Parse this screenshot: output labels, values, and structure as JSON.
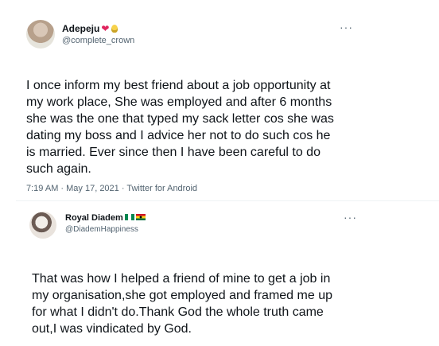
{
  "tweet1": {
    "display_name": "Adepeju",
    "handle": "@complete_crown",
    "text": "I once inform my best friend about a job opportunity at\nmy work place, She was employed and after 6 months\nshe was the one that typed my sack letter cos she was\ndating my boss and I advice her not to do such cos he\nis married. Ever since then I have been careful to do\nsuch again.",
    "meta": "7:19 AM · May 17, 2021 · Twitter for Android",
    "more_glyph": "···",
    "heart_glyph": "❤",
    "name_emoji": [
      "heart-icon",
      "lightbulb-icon"
    ]
  },
  "tweet2": {
    "display_name": "Royal Diadem",
    "handle": "@DiademHappiness",
    "text": "That was how I helped a friend of mine to get a job in\nmy organisation,she got employed and framed me up\nfor what I didn't do.Thank God the whole truth came\nout,I was vindicated by God.",
    "more_glyph": "···",
    "name_emoji": [
      "nigeria-flag-icon",
      "ghana-flag-icon"
    ]
  },
  "colors": {
    "text": "#0f1419",
    "secondary": "#536471",
    "divider": "#eff3f4",
    "heart": "#e0245e"
  }
}
